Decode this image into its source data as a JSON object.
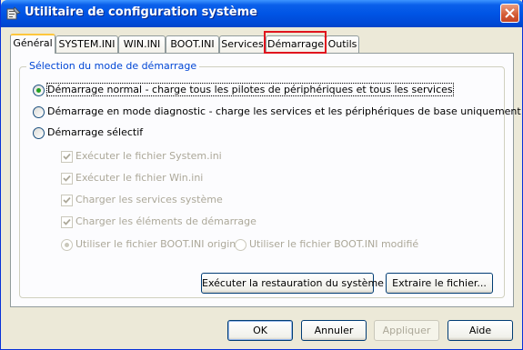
{
  "window": {
    "title": "Utilitaire de configuration système"
  },
  "tabs": [
    {
      "label": "Général"
    },
    {
      "label": "SYSTEM.INI"
    },
    {
      "label": "WIN.INI"
    },
    {
      "label": "BOOT.INI"
    },
    {
      "label": "Services"
    },
    {
      "label": "Démarrage"
    },
    {
      "label": "Outils"
    }
  ],
  "active_tab": "Général",
  "highlighted_tab": "Démarrage",
  "group": {
    "caption": "Sélection du mode de démarrage",
    "radio_normal": "Démarrage normal - charge tous les pilotes de périphériques et tous les services",
    "radio_diagnostic": "Démarrage en mode diagnostic - charge les services et les périphériques de base uniquement",
    "radio_selective": "Démarrage sélectif",
    "checks": [
      {
        "label": "Exécuter le fichier System.ini",
        "checked": true
      },
      {
        "label": "Exécuter le fichier Win.ini",
        "checked": true
      },
      {
        "label": "Charger les services système",
        "checked": true
      },
      {
        "label": "Charger les éléments de démarrage",
        "checked": true
      }
    ],
    "boot_original": "Utiliser le fichier BOOT.INI original",
    "boot_modified": "Utiliser le fichier BOOT.INI modifié",
    "restore_button": "Exécuter la restauration du système",
    "extract_button": "Extraire le fichier..."
  },
  "footer": {
    "ok": "OK",
    "cancel": "Annuler",
    "apply": "Appliquer",
    "help": "Aide"
  },
  "colors": {
    "titlebar": "#0055E5",
    "group_caption": "#0046D5",
    "highlight": "#E0141E",
    "radio_selected": "#21A121"
  }
}
